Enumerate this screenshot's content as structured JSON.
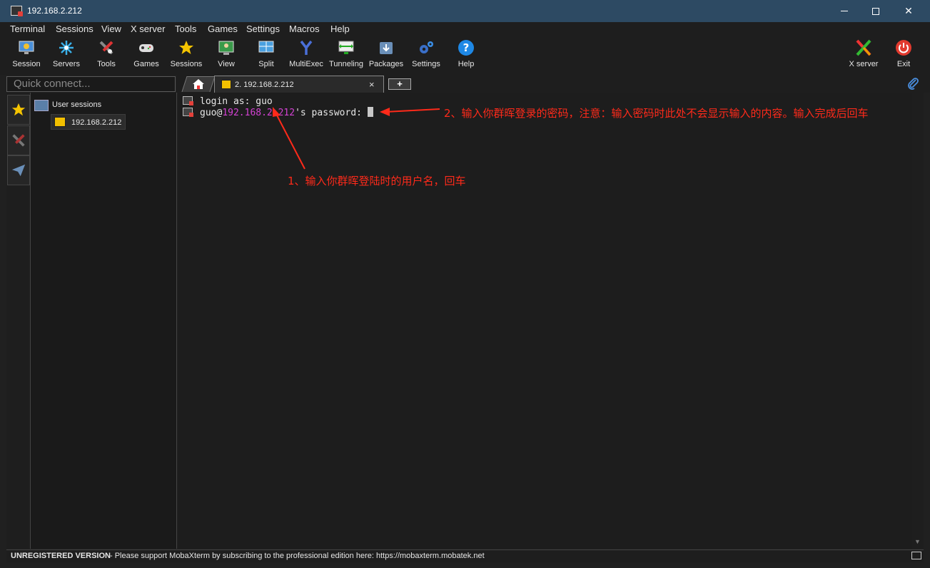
{
  "window": {
    "title": "192.168.2.212"
  },
  "menu": [
    "Terminal",
    "Sessions",
    "View",
    "X server",
    "Tools",
    "Games",
    "Settings",
    "Macros",
    "Help"
  ],
  "toolbar": {
    "left": [
      {
        "label": "Session",
        "icon": "session-icon"
      },
      {
        "label": "Servers",
        "icon": "servers-icon"
      },
      {
        "label": "Tools",
        "icon": "tools-icon"
      },
      {
        "label": "Games",
        "icon": "games-icon"
      },
      {
        "label": "Sessions",
        "icon": "sessions-star-icon"
      },
      {
        "label": "View",
        "icon": "view-icon"
      },
      {
        "label": "Split",
        "icon": "split-icon"
      },
      {
        "label": "MultiExec",
        "icon": "multiexec-icon"
      },
      {
        "label": "Tunneling",
        "icon": "tunneling-icon"
      },
      {
        "label": "Packages",
        "icon": "packages-icon"
      },
      {
        "label": "Settings",
        "icon": "settings-icon"
      },
      {
        "label": "Help",
        "icon": "help-icon"
      }
    ],
    "right": [
      {
        "label": "X server",
        "icon": "xserver-icon"
      },
      {
        "label": "Exit",
        "icon": "exit-icon"
      }
    ]
  },
  "quick_connect": {
    "placeholder": "Quick connect..."
  },
  "tabs": {
    "active": "2. 192.168.2.212",
    "close": "×",
    "new": "+"
  },
  "sidebar": {
    "group_label": "User sessions",
    "session_label": "192.168.2.212"
  },
  "terminal": {
    "line1": {
      "prompt": "login as: ",
      "user": "guo"
    },
    "line2": {
      "user_at": "guo@",
      "host": "192.168.2.212",
      "rest": "'s password: "
    }
  },
  "annotations": {
    "step1": "1、输入你群晖登陆时的用户名，回车",
    "step2": "2、输入你群晖登录的密码，注意：输入密码时此处不会显示输入的内容。输入完成后回车"
  },
  "status": {
    "unregistered": "UNREGISTERED VERSION",
    "message": " -  Please support MobaXterm by subscribing to the professional edition here:",
    "link": "https://mobaxterm.mobatek.net"
  },
  "colors": {
    "annotation": "#ff2a1a",
    "host_highlight": "#d442d4",
    "titlebar": "#2d4a63"
  }
}
